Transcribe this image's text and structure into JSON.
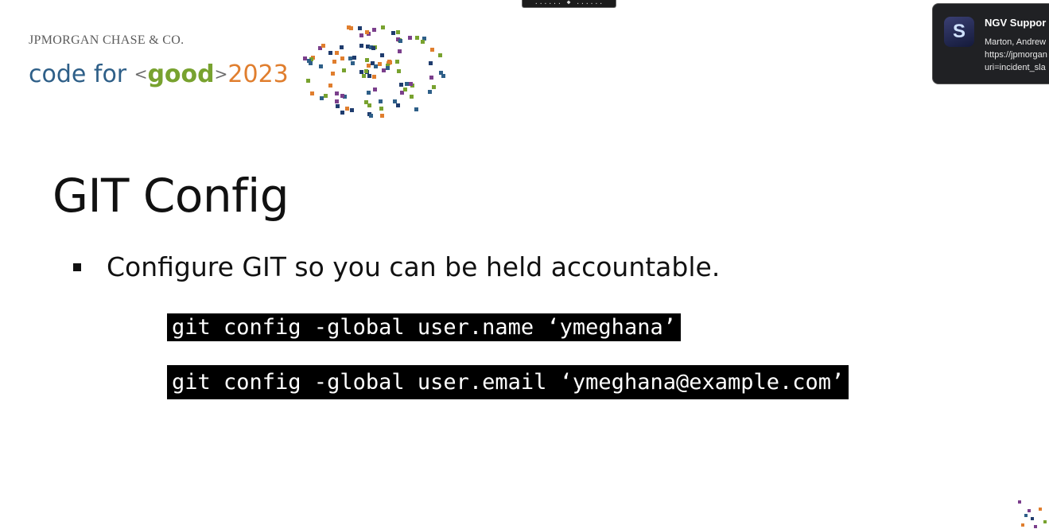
{
  "window": {
    "handle_label": "...... ◆ ......"
  },
  "slide": {
    "brand": "JPMORGAN CHASE & CO.",
    "code_for_good": {
      "prefix": "code for",
      "lt": "<",
      "good": "good",
      "gt": ">",
      "year": "2023"
    },
    "title": "GIT Config",
    "bullet": "Configure GIT so you can be held accountable.",
    "commands": [
      "git config -global user.name ‘ymeghana’",
      "git config -global user.email ‘ymeghana@example.com’"
    ]
  },
  "notification": {
    "icon_letter": "S",
    "title": "NGV Suppor",
    "lines": [
      "Marton, Andrew",
      "https://jpmorgan",
      "uri=incident_sla"
    ]
  },
  "colors": {
    "orange": "#e07e2e",
    "green": "#78a22f",
    "blue": "#2e5f88",
    "purple": "#7b3f8c",
    "navy": "#1f3c6e"
  }
}
